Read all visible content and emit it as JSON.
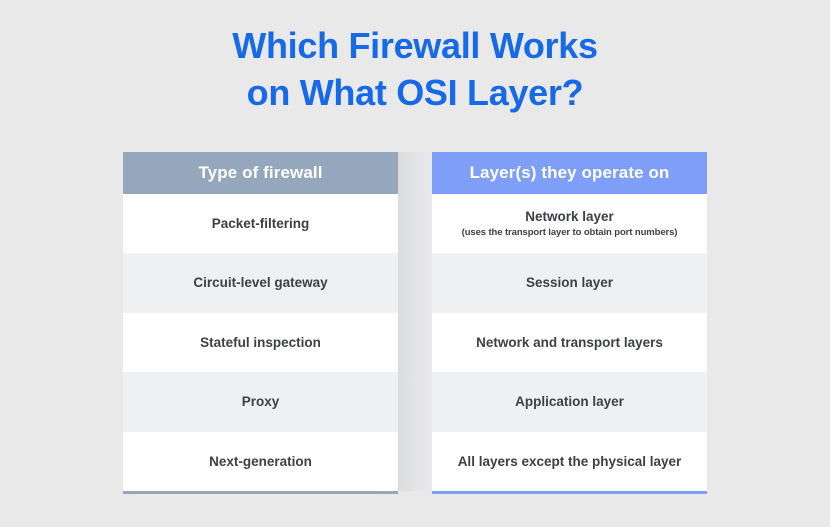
{
  "page": {
    "background_color": "#e9e9ea",
    "title_color": "#1669e8",
    "header_left_color": "#95a7bc",
    "header_right_color": "#7e9ef7",
    "row_alt_color": "#eff0f2",
    "text_color": "#3d4045"
  },
  "title": {
    "line1": "Which Firewall Works",
    "line2": "on What OSI Layer?"
  },
  "table": {
    "columns": [
      {
        "header": "Type of firewall"
      },
      {
        "header": "Layer(s) they operate on"
      }
    ],
    "rows": [
      {
        "firewall_type": "Packet-filtering",
        "layer": "Network layer",
        "layer_note": "(uses the transport layer to obtain port numbers)"
      },
      {
        "firewall_type": "Circuit-level gateway",
        "layer": "Session layer",
        "layer_note": ""
      },
      {
        "firewall_type": "Stateful inspection",
        "layer": "Network and transport layers",
        "layer_note": ""
      },
      {
        "firewall_type": "Proxy",
        "layer": "Application layer",
        "layer_note": ""
      },
      {
        "firewall_type": "Next-generation",
        "layer": "All layers except the physical layer",
        "layer_note": ""
      }
    ]
  }
}
